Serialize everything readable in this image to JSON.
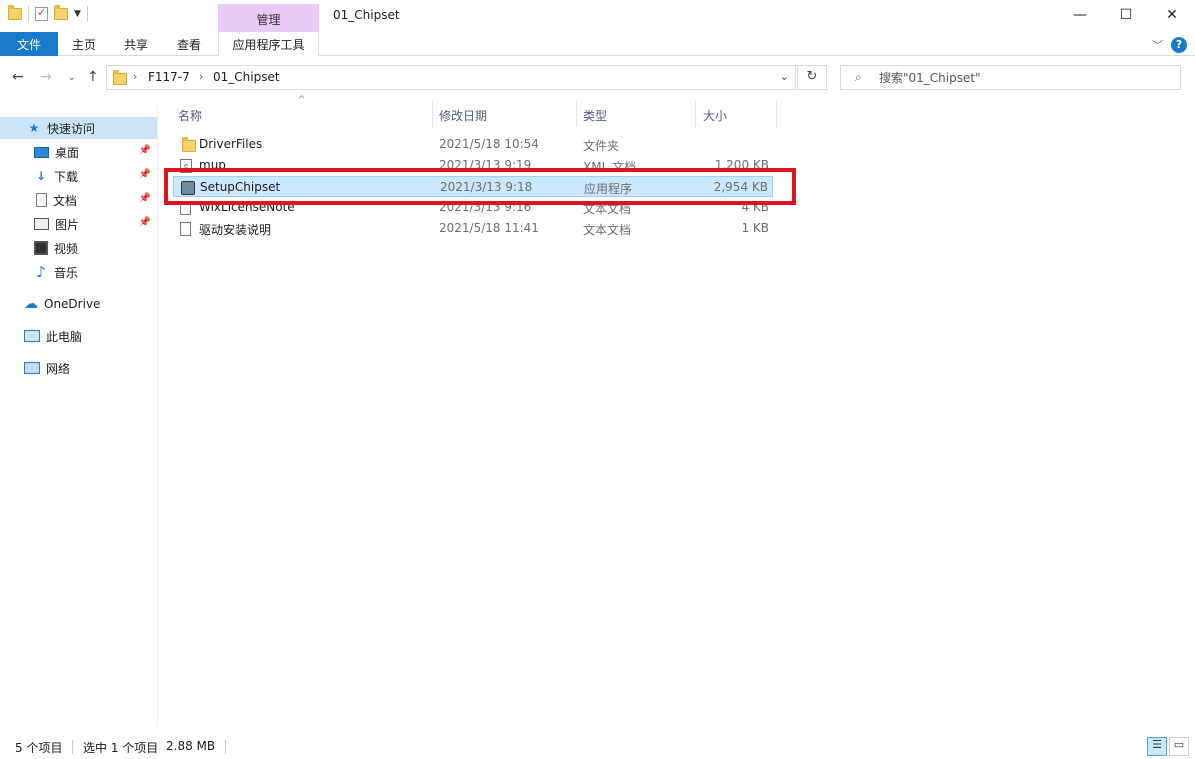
{
  "window": {
    "title": "01_Chipset",
    "contextual_group": "管理",
    "controls": {
      "minimize": "—",
      "maximize": "☐",
      "close": "✕"
    }
  },
  "ribbon": {
    "tabs": [
      "文件",
      "主页",
      "共享",
      "查看",
      "应用程序工具"
    ],
    "help": "?"
  },
  "address": {
    "crumbs": [
      "F117-7",
      "01_Chipset"
    ],
    "search_placeholder": "搜索\"01_Chipset\""
  },
  "sidebar": {
    "items": [
      {
        "label": "快速访问",
        "icon": "star-icon",
        "selected": true
      },
      {
        "label": "桌面",
        "icon": "desktop-icon",
        "pinned": true
      },
      {
        "label": "下载",
        "icon": "download-icon",
        "pinned": true
      },
      {
        "label": "文档",
        "icon": "documents-icon",
        "pinned": true
      },
      {
        "label": "图片",
        "icon": "pictures-icon",
        "pinned": true
      },
      {
        "label": "视频",
        "icon": "videos-icon"
      },
      {
        "label": "音乐",
        "icon": "music-icon"
      },
      {
        "label": "OneDrive",
        "icon": "onedrive-icon"
      },
      {
        "label": "此电脑",
        "icon": "this-pc-icon"
      },
      {
        "label": "网络",
        "icon": "network-icon"
      }
    ]
  },
  "columns": {
    "name": "名称",
    "date": "修改日期",
    "type": "类型",
    "size": "大小"
  },
  "files": [
    {
      "name": "DriverFiles",
      "date": "2021/5/18 10:54",
      "type": "文件夹",
      "size": "",
      "icon": "folder-icon"
    },
    {
      "name": "mup",
      "date": "2021/3/13 9:19",
      "type": "XML 文档",
      "size": "1,200 KB",
      "icon": "xml-file-icon"
    },
    {
      "name": "SetupChipset",
      "date": "2021/3/13 9:18",
      "type": "应用程序",
      "size": "2,954 KB",
      "icon": "exe-file-icon",
      "selected": true
    },
    {
      "name": "WixLicenseNote",
      "date": "2021/3/13 9:16",
      "type": "文本文档",
      "size": "4 KB",
      "icon": "text-file-icon"
    },
    {
      "name": "驱动安装说明",
      "date": "2021/5/18 11:41",
      "type": "文本文档",
      "size": "1 KB",
      "icon": "text-file-icon"
    }
  ],
  "status": {
    "item_count": "5 个项目",
    "selection": "选中 1 个项目",
    "selection_size": "2.88 MB"
  },
  "colors": {
    "accent": "#1979ca",
    "selection_bg": "#cce8ff",
    "highlight_border": "#e0141e",
    "context_tab": "#eacbf5"
  }
}
